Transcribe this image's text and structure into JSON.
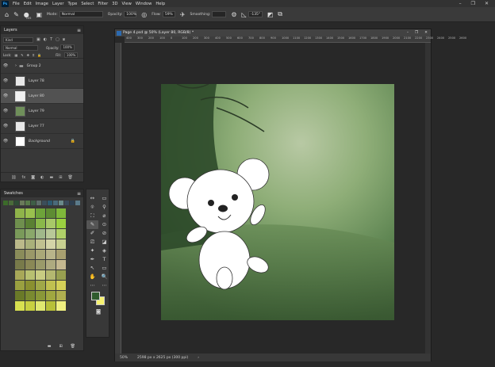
{
  "menu": {
    "logo": "Ps",
    "items": [
      "File",
      "Edit",
      "Image",
      "Layer",
      "Type",
      "Select",
      "Filter",
      "3D",
      "View",
      "Window",
      "Help"
    ]
  },
  "options": {
    "mode_label": "Mode:",
    "mode_value": "Normal",
    "opacity_label": "Opacity:",
    "opacity_value": "100%",
    "flow_label": "Flow:",
    "flow_value": "59%",
    "smoothing_label": "Smoothing:",
    "angle_value": "-135°",
    "brush_size": "105"
  },
  "layers_panel": {
    "title": "Layers",
    "filter": "Kind",
    "blend": "Normal",
    "opacity_label": "Opacity:",
    "opacity_value": "100%",
    "lock_label": "Lock:",
    "fill_label": "Fill:",
    "fill_value": "100%",
    "layers": [
      {
        "name": "Group 2",
        "selected": false
      },
      {
        "name": "Layer 78",
        "selected": false
      },
      {
        "name": "Layer 80",
        "selected": true
      },
      {
        "name": "Layer 79",
        "selected": false
      },
      {
        "name": "Layer 77",
        "selected": false
      },
      {
        "name": "Background",
        "selected": false
      }
    ]
  },
  "swatches_panel": {
    "title": "Swatches",
    "recent": [
      "#3c6b2a",
      "#4a6b3a",
      "#2f4d35",
      "#6a7a5a",
      "#587a4a",
      "#3e5e46",
      "#5d6e6a",
      "#3b4e5a",
      "#2e5a70",
      "#4a6a7a",
      "#6a8a8a",
      "#3a4a5a",
      "#2e3e4e",
      "#5a7a8a"
    ],
    "colors": [
      "#8fb34a",
      "#9ac04e",
      "#6ea33a",
      "#5e8c33",
      "#7fb83a",
      "#6f8f4e",
      "#5a8033",
      "#8ab84a",
      "#a8c868",
      "#9ad040",
      "#7a9a5a",
      "#8aa86a",
      "#a0b88a",
      "#b8c898",
      "#b0d068",
      "#bbb98a",
      "#a9b07a",
      "#c0c090",
      "#d4d4a8",
      "#c8d090",
      "#8a8c5a",
      "#9a9868",
      "#aaa878",
      "#b8b48a",
      "#a8a070",
      "#787a4a",
      "#8a8856",
      "#9a9a6a",
      "#aeaa80",
      "#c4b890",
      "#a8a858",
      "#b8c070",
      "#c8cc82",
      "#b4b870",
      "#98a050",
      "#9aa040",
      "#8a9030",
      "#a0a848",
      "#c0c050",
      "#d4d058",
      "#6a7a28",
      "#7a8a30",
      "#8a9838",
      "#a0a840",
      "#b0b050",
      "#d8e050",
      "#c8d040",
      "#e0e870",
      "#b8c038",
      "#f0f080"
    ]
  },
  "tools": [
    "↔",
    "▭",
    "⌾",
    "⚲",
    "⛶",
    "⌀",
    "✎",
    "⊙",
    "✐",
    "⊘",
    "⎚",
    "◪",
    "✦",
    "◈",
    "✒",
    "T",
    "↖",
    "▭",
    "✋",
    "🔍",
    "⋯"
  ],
  "foreground_color": "#2f5b2e",
  "background_color": "#f7f270",
  "document": {
    "tab_title": "Page 4.psd @ 50% (Layer 80, RGB/8) *",
    "zoom": "50%",
    "size": "2598 px x 2625 px (300 ppi)",
    "ruler_x": [
      "400",
      "300",
      "200",
      "100",
      "0",
      "100",
      "200",
      "300",
      "400",
      "500",
      "600",
      "700",
      "800",
      "900",
      "1000",
      "1100",
      "1200",
      "1300",
      "1400",
      "1500",
      "1600",
      "1700",
      "1800",
      "1900",
      "2000",
      "2100",
      "2200",
      "2300",
      "2400",
      "2500",
      "2600"
    ]
  }
}
